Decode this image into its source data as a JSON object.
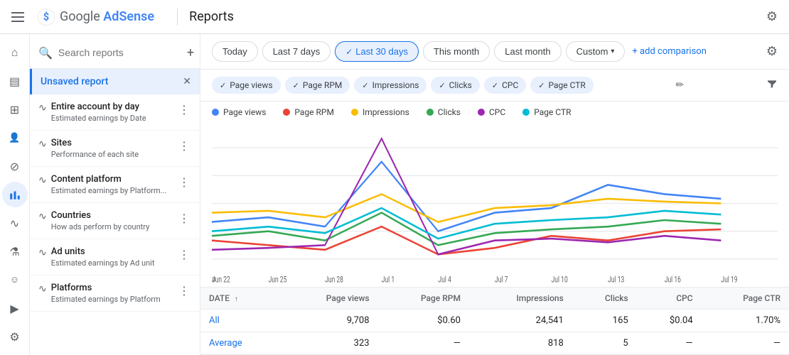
{
  "app": {
    "hamburger_label": "menu",
    "logo_text": "Google ",
    "logo_brand": "AdSense",
    "page_title": "Reports",
    "settings_label": "settings"
  },
  "filter_bar": {
    "today": "Today",
    "last7": "Last 7 days",
    "last30": "Last 30 days",
    "this_month": "This month",
    "last_month": "Last month",
    "custom": "Custom",
    "add_comparison": "+ add comparison"
  },
  "sidebar": {
    "search_placeholder": "Search reports",
    "add_label": "+",
    "active_item": "Unsaved report",
    "items": [
      {
        "name": "Entire account by day",
        "desc": "Estimated earnings by Date"
      },
      {
        "name": "Sites",
        "desc": "Performance of each site"
      },
      {
        "name": "Content platform",
        "desc": "Estimated earnings by Platform..."
      },
      {
        "name": "Countries",
        "desc": "How ads perform by country"
      },
      {
        "name": "Ad units",
        "desc": "Estimated earnings by Ad unit"
      },
      {
        "name": "Platforms",
        "desc": "Estimated earnings by Platform"
      }
    ]
  },
  "metrics": [
    {
      "label": "Page views",
      "active": true,
      "color": "#4285f4"
    },
    {
      "label": "Page RPM",
      "active": true,
      "color": "#ea4335"
    },
    {
      "label": "Impressions",
      "active": true,
      "color": "#fbbc04"
    },
    {
      "label": "Clicks",
      "active": true,
      "color": "#34a853"
    },
    {
      "label": "CPC",
      "active": true,
      "color": "#9c27b0"
    },
    {
      "label": "Page CTR",
      "active": true,
      "color": "#00bcd4"
    }
  ],
  "chart": {
    "x_labels": [
      "Jun 22",
      "Jun 25",
      "Jun 28",
      "Jul 1",
      "Jul 4",
      "Jul 7",
      "Jul 10",
      "Jul 13",
      "Jul 16",
      "Jul 19"
    ]
  },
  "table": {
    "columns": [
      "DATE",
      "Page views",
      "Page RPM",
      "Impressions",
      "Clicks",
      "CPC",
      "Page CTR"
    ],
    "rows": [
      {
        "date": "All",
        "page_views": "9,708",
        "page_rpm": "$0.60",
        "impressions": "24,541",
        "clicks": "165",
        "cpc": "$0.04",
        "page_ctr": "1.70%"
      },
      {
        "date": "Average",
        "page_views": "323",
        "page_rpm": "—",
        "impressions": "818",
        "clicks": "5",
        "cpc": "—",
        "page_ctr": "—"
      }
    ]
  },
  "side_nav_icons": [
    {
      "name": "home-icon",
      "symbol": "⌂",
      "active": false
    },
    {
      "name": "pages-icon",
      "symbol": "▤",
      "active": false
    },
    {
      "name": "content-icon",
      "symbol": "⊞",
      "active": false
    },
    {
      "name": "audience-icon",
      "symbol": "👤",
      "active": false
    },
    {
      "name": "block-icon",
      "symbol": "⊘",
      "active": false
    },
    {
      "name": "reports-icon",
      "symbol": "📊",
      "active": true
    },
    {
      "name": "analytics-icon",
      "symbol": "〜",
      "active": false
    },
    {
      "name": "experiments-icon",
      "symbol": "⚙",
      "active": false
    },
    {
      "name": "account-icon",
      "symbol": "☺",
      "active": false
    },
    {
      "name": "video-icon",
      "symbol": "▶",
      "active": false
    },
    {
      "name": "settings2-icon",
      "symbol": "⚙",
      "active": false
    },
    {
      "name": "help-icon",
      "symbol": "?",
      "active": false
    }
  ]
}
